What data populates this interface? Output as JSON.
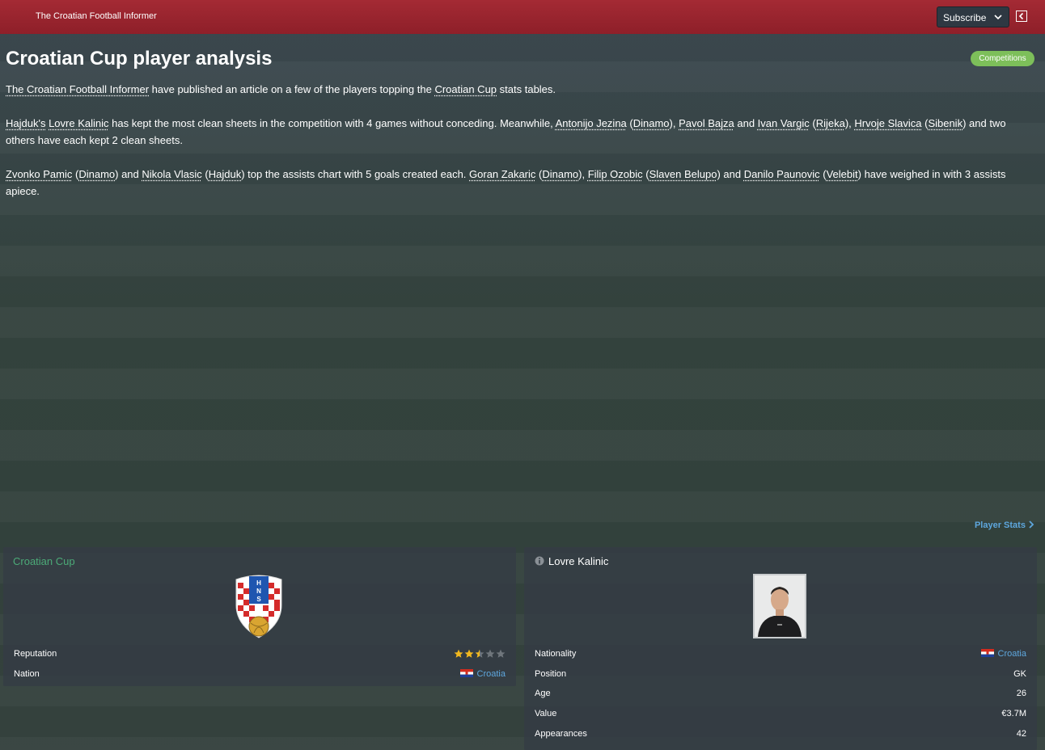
{
  "topbar": {
    "source": "The Croatian Football Informer",
    "subscribe_label": "Subscribe"
  },
  "article": {
    "title": "Croatian Cup player analysis",
    "tag": "Competitions",
    "p1": {
      "link1": "The Croatian Football Informer",
      "t1": " have published an article on a few of the players topping the ",
      "link2": "Croatian Cup",
      "t2": " stats tables."
    },
    "p2": {
      "l1": "Hajduk's",
      "s1": " ",
      "l2": "Lovre Kalinic",
      "s2": " has kept the most clean sheets in the competition with 4 games without conceding. Meanwhile, ",
      "l3": "Antonijo Jezina",
      "s3": " (",
      "l4": "Dinamo",
      "s4": "), ",
      "l5": "Pavol Bajza",
      "s5": " and ",
      "l6": "Ivan Vargic",
      "s6": " (",
      "l7": "Rijeka",
      "s7": "), ",
      "l8": "Hrvoje Slavica",
      "s8": " (",
      "l9": "Sibenik",
      "s9": ") and two others have each kept 2 clean sheets."
    },
    "p3": {
      "l1": "Zvonko Pamic",
      "s1": " (",
      "l2": "Dinamo",
      "s2": ") and ",
      "l3": "Nikola Vlasic",
      "s3": " (",
      "l4": "Hajduk",
      "s4": ") top the assists chart with 5 goals created each. ",
      "l5": "Goran Zakaric",
      "s5": " (",
      "l6": "Dinamo",
      "s6": "), ",
      "l7": "Filip Ozobic",
      "s7": " (",
      "l8": "Slaven Belupo",
      "s8": ") and ",
      "l9": "Danilo Paunovic",
      "s9": " (",
      "l10": "Velebit",
      "s10": ") have weighed in with 3 assists apiece."
    },
    "player_stats_link": "Player Stats"
  },
  "competition_card": {
    "title": "Croatian Cup",
    "rows": [
      {
        "label": "Reputation",
        "stars": 2.5,
        "max_stars": 5
      },
      {
        "label": "Nation",
        "value": "Croatia"
      }
    ]
  },
  "player_card": {
    "name": "Lovre Kalinic",
    "rows": [
      {
        "label": "Nationality",
        "value": "Croatia"
      },
      {
        "label": "Position",
        "value": "GK"
      },
      {
        "label": "Age",
        "value": "26"
      },
      {
        "label": "Value",
        "value": "€3.7M"
      },
      {
        "label": "Appearances",
        "value": "42"
      }
    ]
  },
  "colors": {
    "topbar": "#a42a34",
    "tag": "#7dbf5a",
    "link": "#5ea7de",
    "card_title_green": "#4caa78",
    "star": "#f2b81e"
  },
  "icons": [
    "chevron-down-icon",
    "collapse-panel-icon",
    "info-icon",
    "chevron-right-icon",
    "croatia-flag-icon",
    "star-icon"
  ]
}
